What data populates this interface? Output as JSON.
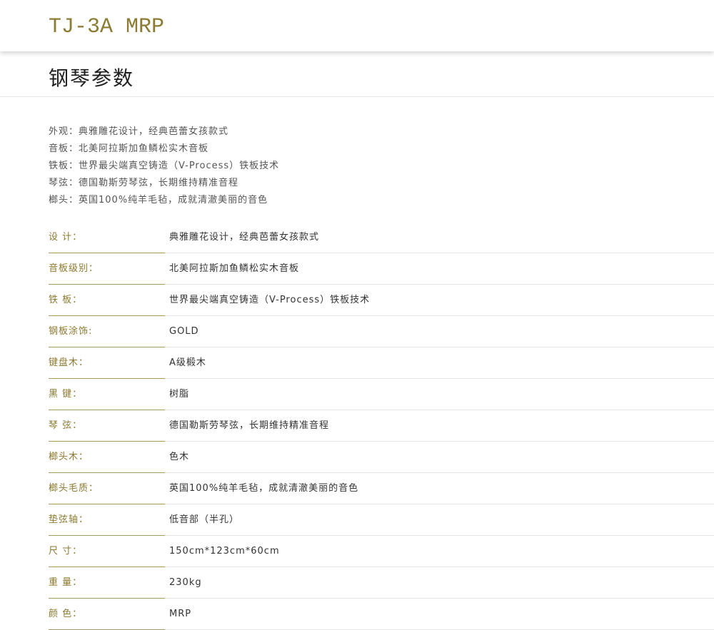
{
  "header": {
    "title": "TJ-3A MRP"
  },
  "section": {
    "heading": "钢琴参数"
  },
  "features": [
    "外观：典雅雕花设计，经典芭蕾女孩款式",
    "音板：北美阿拉斯加鱼鳞松实木音板",
    "铁板：世界最尖端真空铸造（V-Process）铁板技术",
    "琴弦：德国勒斯劳琴弦，长期维持精准音程",
    "榔头：英国100%纯羊毛毡，成就清澈美丽的音色"
  ],
  "specs": [
    {
      "label": "设 计：",
      "value": "典雅雕花设计，经典芭蕾女孩款式"
    },
    {
      "label": "音板级别：",
      "value": "北美阿拉斯加鱼鳞松实木音板"
    },
    {
      "label": "铁 板：",
      "value": "世界最尖端真空铸造（V-Process）铁板技术"
    },
    {
      "label": "钢板涂饰:",
      "value": "GOLD"
    },
    {
      "label": "键盘木：",
      "value": "A级椴木"
    },
    {
      "label": "黑 键：",
      "value": "树脂"
    },
    {
      "label": "琴 弦：",
      "value": "德国勒斯劳琴弦，长期维持精准音程"
    },
    {
      "label": "榔头木：",
      "value": "色木"
    },
    {
      "label": "榔头毛质：",
      "value": "英国100%纯羊毛毡，成就清澈美丽的音色"
    },
    {
      "label": "垫弦轴：",
      "value": "低音部（半孔）"
    },
    {
      "label": "尺 寸：",
      "value": "150cm*123cm*60cm"
    },
    {
      "label": "重 量：",
      "value": "230kg"
    },
    {
      "label": "颜 色：",
      "value": "MRP"
    }
  ],
  "colors": {
    "accent": "#8b7b33",
    "label_rule": "#a69a63",
    "value_rule": "#e6e6e6"
  }
}
